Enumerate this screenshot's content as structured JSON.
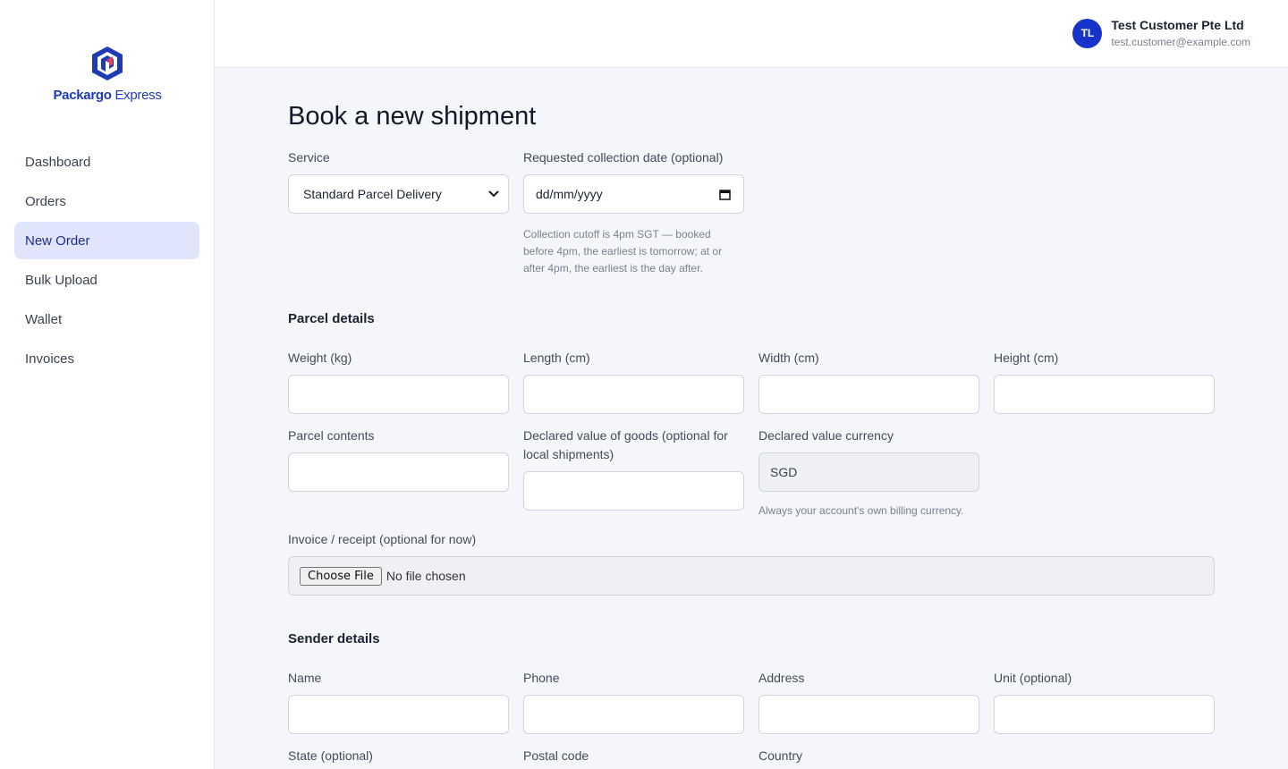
{
  "brand": {
    "name": "Packargo",
    "suffix": " Express"
  },
  "nav": [
    {
      "label": "Dashboard",
      "active": false
    },
    {
      "label": "Orders",
      "active": false
    },
    {
      "label": "New Order",
      "active": true
    },
    {
      "label": "Bulk Upload",
      "active": false
    },
    {
      "label": "Wallet",
      "active": false
    },
    {
      "label": "Invoices",
      "active": false
    }
  ],
  "user": {
    "initials": "TL",
    "name": "Test Customer Pte Ltd",
    "email": "test.customer@example.com"
  },
  "page_title": "Book a new shipment",
  "service": {
    "label": "Service",
    "selected": "Standard Parcel Delivery",
    "icon": "chevron-down-icon"
  },
  "collection": {
    "label": "Requested collection date (optional)",
    "value": "dd/mm/yyyy",
    "icon": "calendar-icon",
    "help": "Collection cutoff is 4pm SGT — booked before 4pm, the earliest is tomorrow; at or after 4pm, the earliest is the day after."
  },
  "parcel": {
    "title": "Parcel details",
    "weight_label": "Weight (kg)",
    "length_label": "Length (cm)",
    "width_label": "Width (cm)",
    "height_label": "Height (cm)",
    "contents_label": "Parcel contents",
    "declared_label": "Declared value of goods (optional for local shipments)",
    "currency_label": "Declared value currency",
    "currency_value": "SGD",
    "currency_help": "Always your account's own billing currency.",
    "invoice_label": "Invoice / receipt (optional for now)",
    "file_button": "Choose File",
    "file_status": "No file chosen"
  },
  "sender": {
    "title": "Sender details",
    "name_label": "Name",
    "phone_label": "Phone",
    "address_label": "Address",
    "unit_label": "Unit (optional)",
    "state_label": "State (optional)",
    "postal_label": "Postal code",
    "country_label": "Country"
  },
  "colors": {
    "accent": "#1733c9",
    "nav_active_bg": "#e1e5fb",
    "logo_red": "#e8435a",
    "logo_blue": "#1f3bb3"
  }
}
